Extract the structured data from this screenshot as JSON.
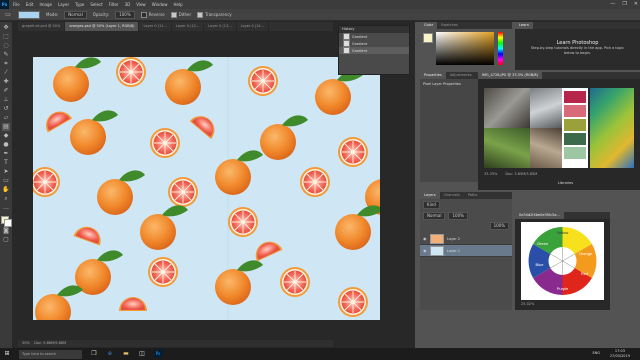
{
  "app": {
    "logo": "Ps",
    "menu": [
      "File",
      "Edit",
      "Image",
      "Layer",
      "Type",
      "Select",
      "Filter",
      "3D",
      "View",
      "Window",
      "Help"
    ],
    "window_controls": [
      "—",
      "❐",
      "✕"
    ]
  },
  "options_bar": {
    "mode_label": "Mode:",
    "mode_value": "Normal",
    "opacity_label": "Opacity:",
    "opacity_value": "100%",
    "reverse_label": "Reverse",
    "dither_label": "Dither",
    "transparency_label": "Transparency"
  },
  "doc_tabs": [
    "grapefruit.psd @ 50%",
    "oranges.psd @ 50% (Layer 1, RGB/8)",
    "Layer 0 (11...",
    "Layer 0 (12...",
    "Layer 0 (13...",
    "Layer 0 (14..."
  ],
  "history": {
    "title": "History",
    "items": [
      "Gradient",
      "Gradient",
      "Gradient"
    ]
  },
  "color_panel": {
    "tabs": [
      "Color",
      "Swatches"
    ]
  },
  "learn": {
    "tab": "Learn",
    "title": "Learn Photoshop",
    "description": "Step-by-step tutorials directly in the app. Pick a topic below to begin."
  },
  "properties": {
    "tabs": [
      "Properties",
      "Adjustments"
    ],
    "subtitle": "Pixel Layer Properties"
  },
  "photo_doc": {
    "tab": "IMG_4728.JPG @ 33.3% (RGB/8)",
    "status": "33.33%",
    "doc_info": "Doc: 3.85M/3.85M",
    "sub_tab": "Libraries"
  },
  "layers": {
    "tabs": [
      "Layers",
      "Channels",
      "Paths"
    ],
    "kind": "Kind",
    "blend": "Normal",
    "opacity": "100%",
    "fill": "100%",
    "items": [
      "Layer 2",
      "Layer 1"
    ]
  },
  "wheel_doc": {
    "tab": "0e34d2f4be0e3f0c5a...",
    "status": "25.02%",
    "labels": [
      "Yellow",
      "Red",
      "Blue",
      "Purple",
      "Green",
      "Orange"
    ]
  },
  "status": {
    "zoom": "50%",
    "doc": "Doc: 9.86M/9.86M"
  },
  "taskbar": {
    "search": "Type here to search",
    "time": "17:03",
    "date": "27/03/2019",
    "lang": "ENG"
  },
  "colors": {
    "accent": "#31a8ff",
    "canvas_bg": "#cfe7f5",
    "orange": "#f08c2e",
    "pink": "#f27b6b"
  }
}
